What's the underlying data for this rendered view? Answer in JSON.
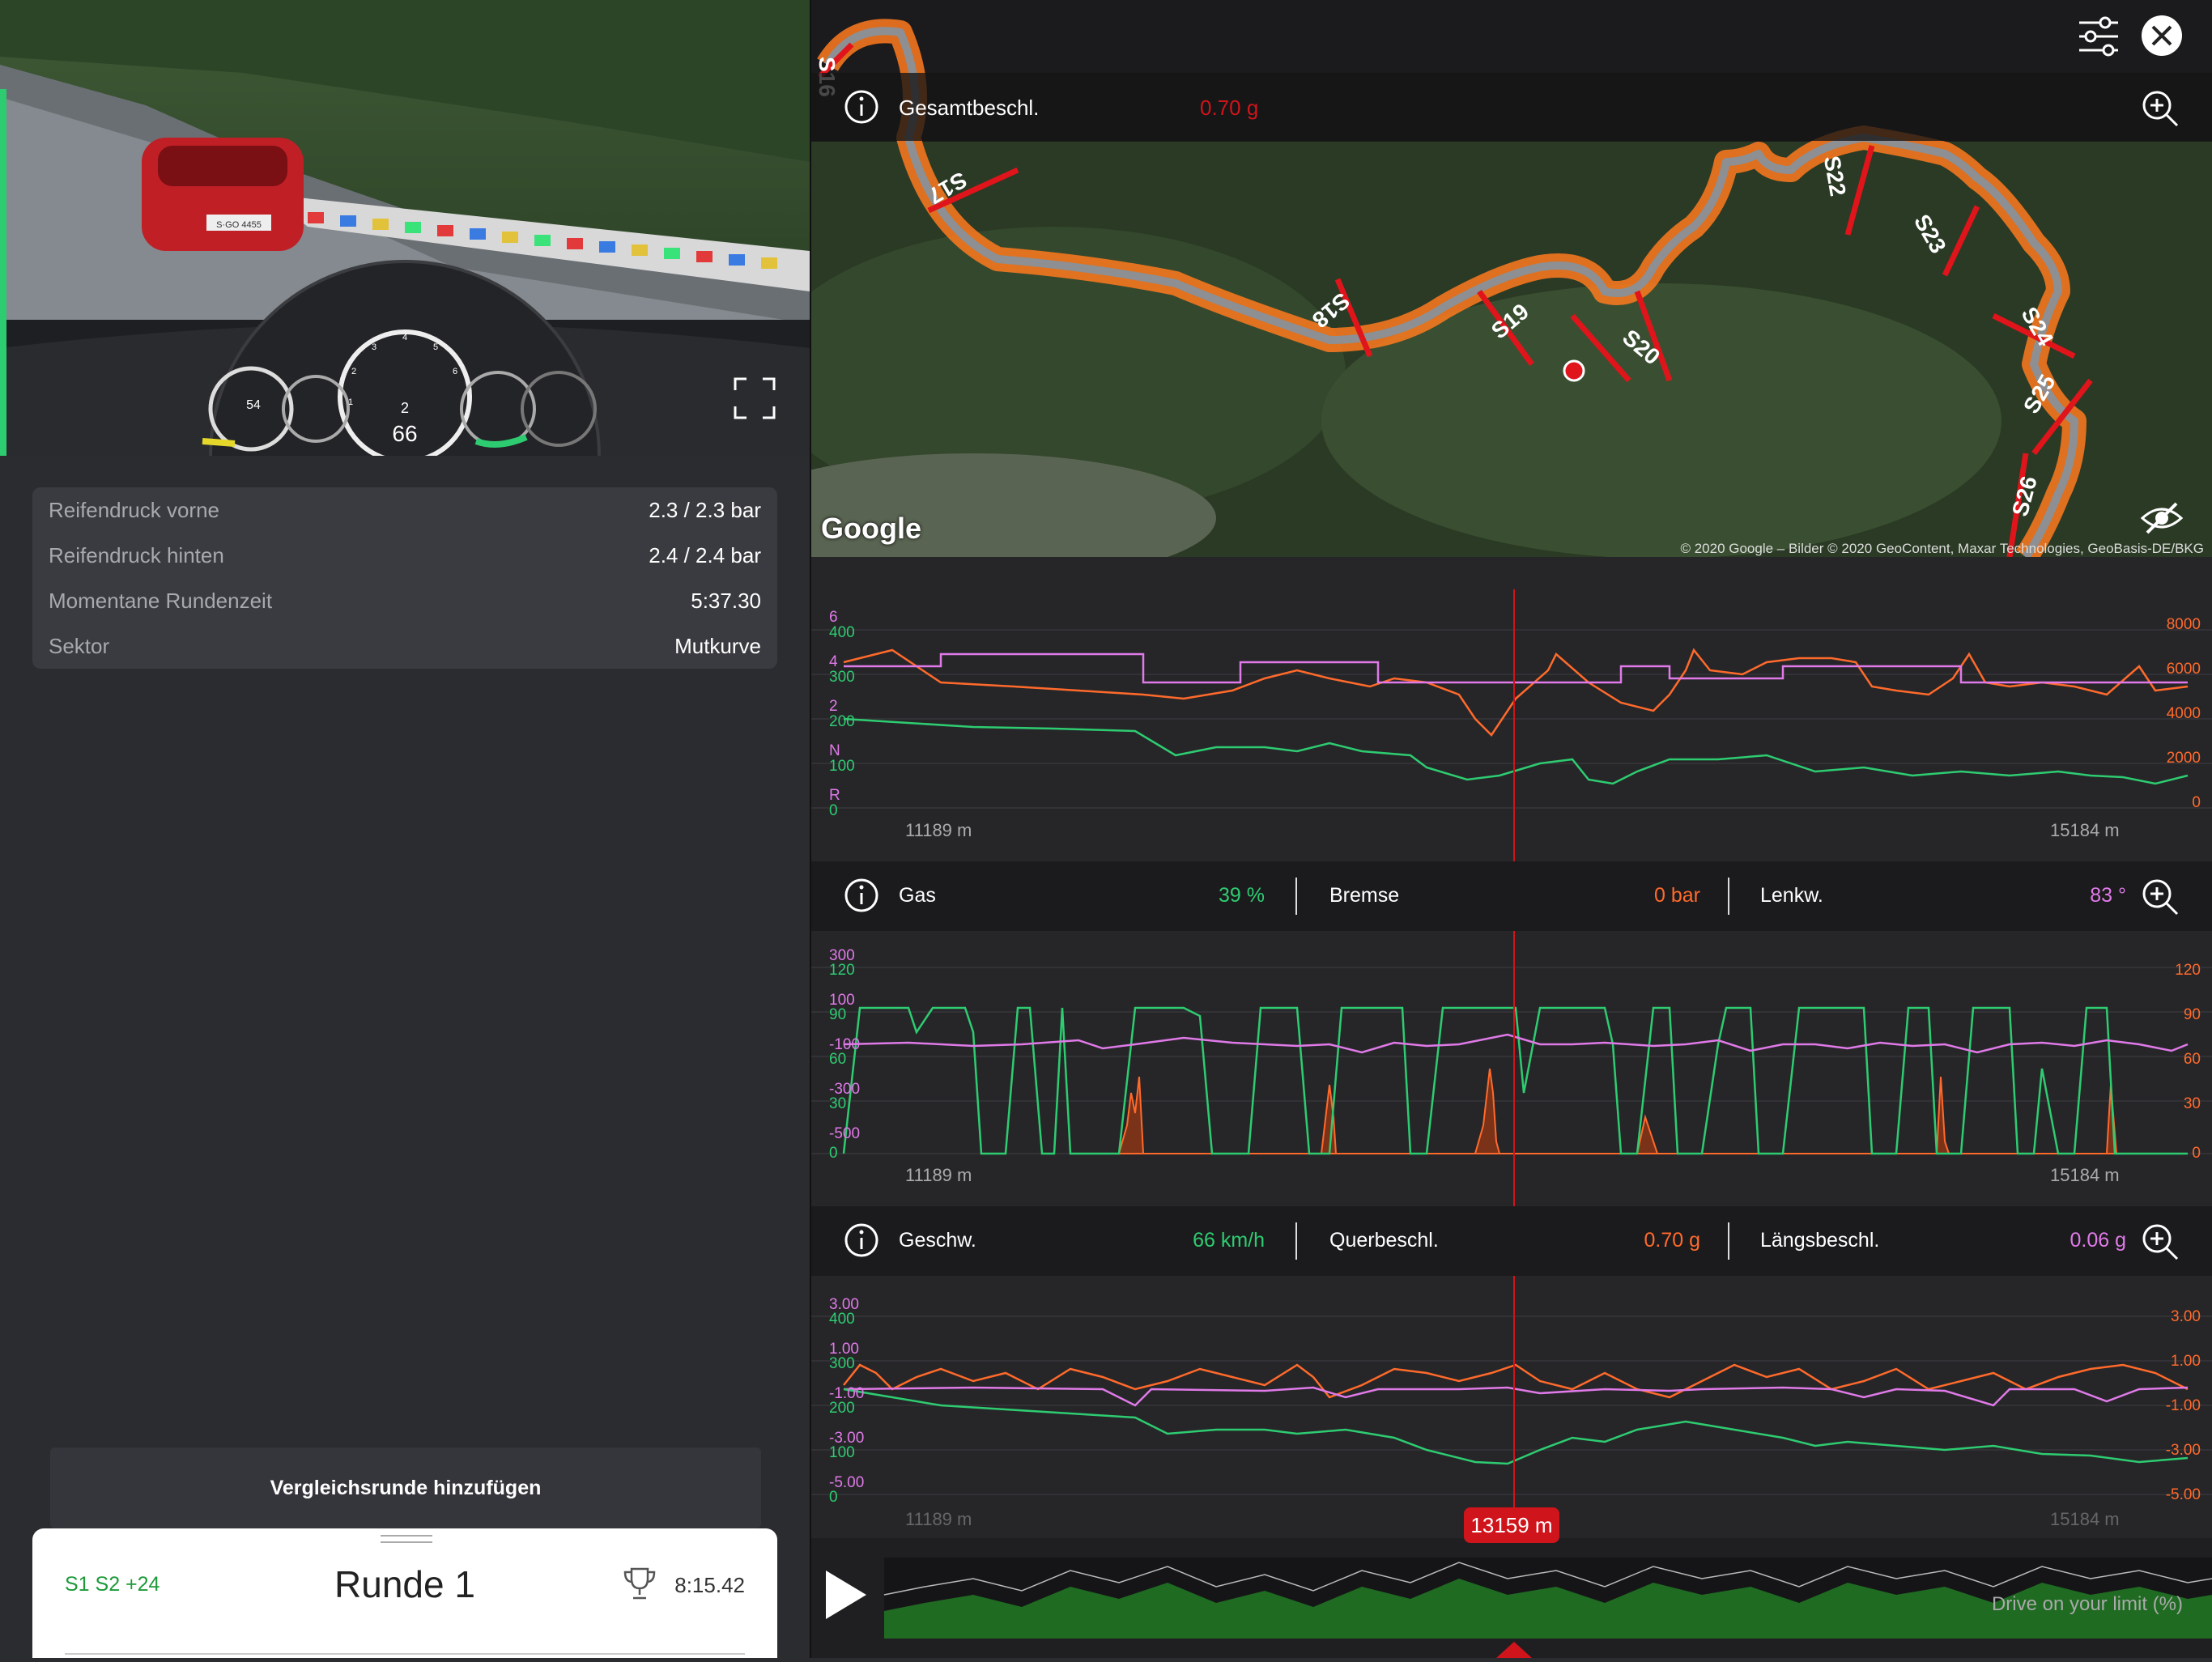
{
  "left": {
    "info": [
      {
        "key": "Reifendruck vorne",
        "value": "2.3 / 2.3 bar"
      },
      {
        "key": "Reifendruck hinten",
        "value": "2.4 / 2.4 bar"
      },
      {
        "key": "Momentane Rundenzeit",
        "value": "5:37.30"
      },
      {
        "key": "Sektor",
        "value": "Mutkurve"
      }
    ],
    "video": {
      "speed": "66",
      "gear": "2",
      "gauge_left": "54",
      "gauge_ticks": [
        "1",
        "2",
        "3",
        "4",
        "5",
        "6"
      ],
      "plate": "S·GO 4455"
    },
    "compare_button": "Vergleichsrunde hinzufügen",
    "lap": {
      "sectors": "S1 S2 +24",
      "title": "Runde 1",
      "best": "8:15.42"
    }
  },
  "map": {
    "header_label": "Gesamtbeschl.",
    "header_value": "0.70 g",
    "sector_labels": [
      "S16",
      "S17",
      "S18",
      "S19",
      "S20",
      "S22",
      "S23",
      "S24",
      "S25",
      "S26"
    ],
    "google": "Google",
    "attribution": "© 2020 Google – Bilder © 2020 GeoContent, Maxar Technologies, GeoBasis-DE/BKG"
  },
  "charts": [
    {
      "header": null,
      "left_ticks_top": [
        "6",
        "4",
        "2",
        "N",
        "R"
      ],
      "left_ticks": [
        "400",
        "300",
        "200",
        "100",
        "0"
      ],
      "right_ticks": [
        "8000",
        "6000",
        "4000",
        "2000",
        "0"
      ],
      "x_start": "11189 m",
      "x_end": "15184 m"
    },
    {
      "header": {
        "c1": {
          "label": "Gas",
          "value": "39 %"
        },
        "c2": {
          "label": "Bremse",
          "value": "0 bar"
        },
        "c3": {
          "label": "Lenkw.",
          "value": "83 °"
        }
      },
      "left_ticks_top": [
        "300",
        "100",
        "-100",
        "-300",
        "-500"
      ],
      "left_ticks": [
        "120",
        "90",
        "60",
        "30",
        "0"
      ],
      "right_ticks": [
        "120",
        "90",
        "60",
        "30",
        "0"
      ],
      "x_start": "11189 m",
      "x_end": "15184 m"
    },
    {
      "header": {
        "c1": {
          "label": "Geschw.",
          "value": "66 km/h"
        },
        "c2": {
          "label": "Querbeschl.",
          "value": "0.70 g"
        },
        "c3": {
          "label": "Längsbeschl.",
          "value": "0.06 g"
        }
      },
      "left_ticks_top": [
        "3.00",
        "1.00",
        "-1.00",
        "-3.00",
        "-5.00"
      ],
      "left_ticks": [
        "400",
        "300",
        "200",
        "100",
        "0"
      ],
      "right_ticks": [
        "3.00",
        "1.00",
        "-1.00",
        "-3.00",
        "-5.00"
      ],
      "x_start": "11189 m",
      "x_end": "15184 m"
    }
  ],
  "colors": {
    "green": "#2ecc71",
    "orange": "#ff6a2b",
    "pink": "#e07ae8",
    "red": "#d0141b"
  },
  "bottom": {
    "distance": "13159 m",
    "limit_label": "Drive on your limit (%)"
  }
}
